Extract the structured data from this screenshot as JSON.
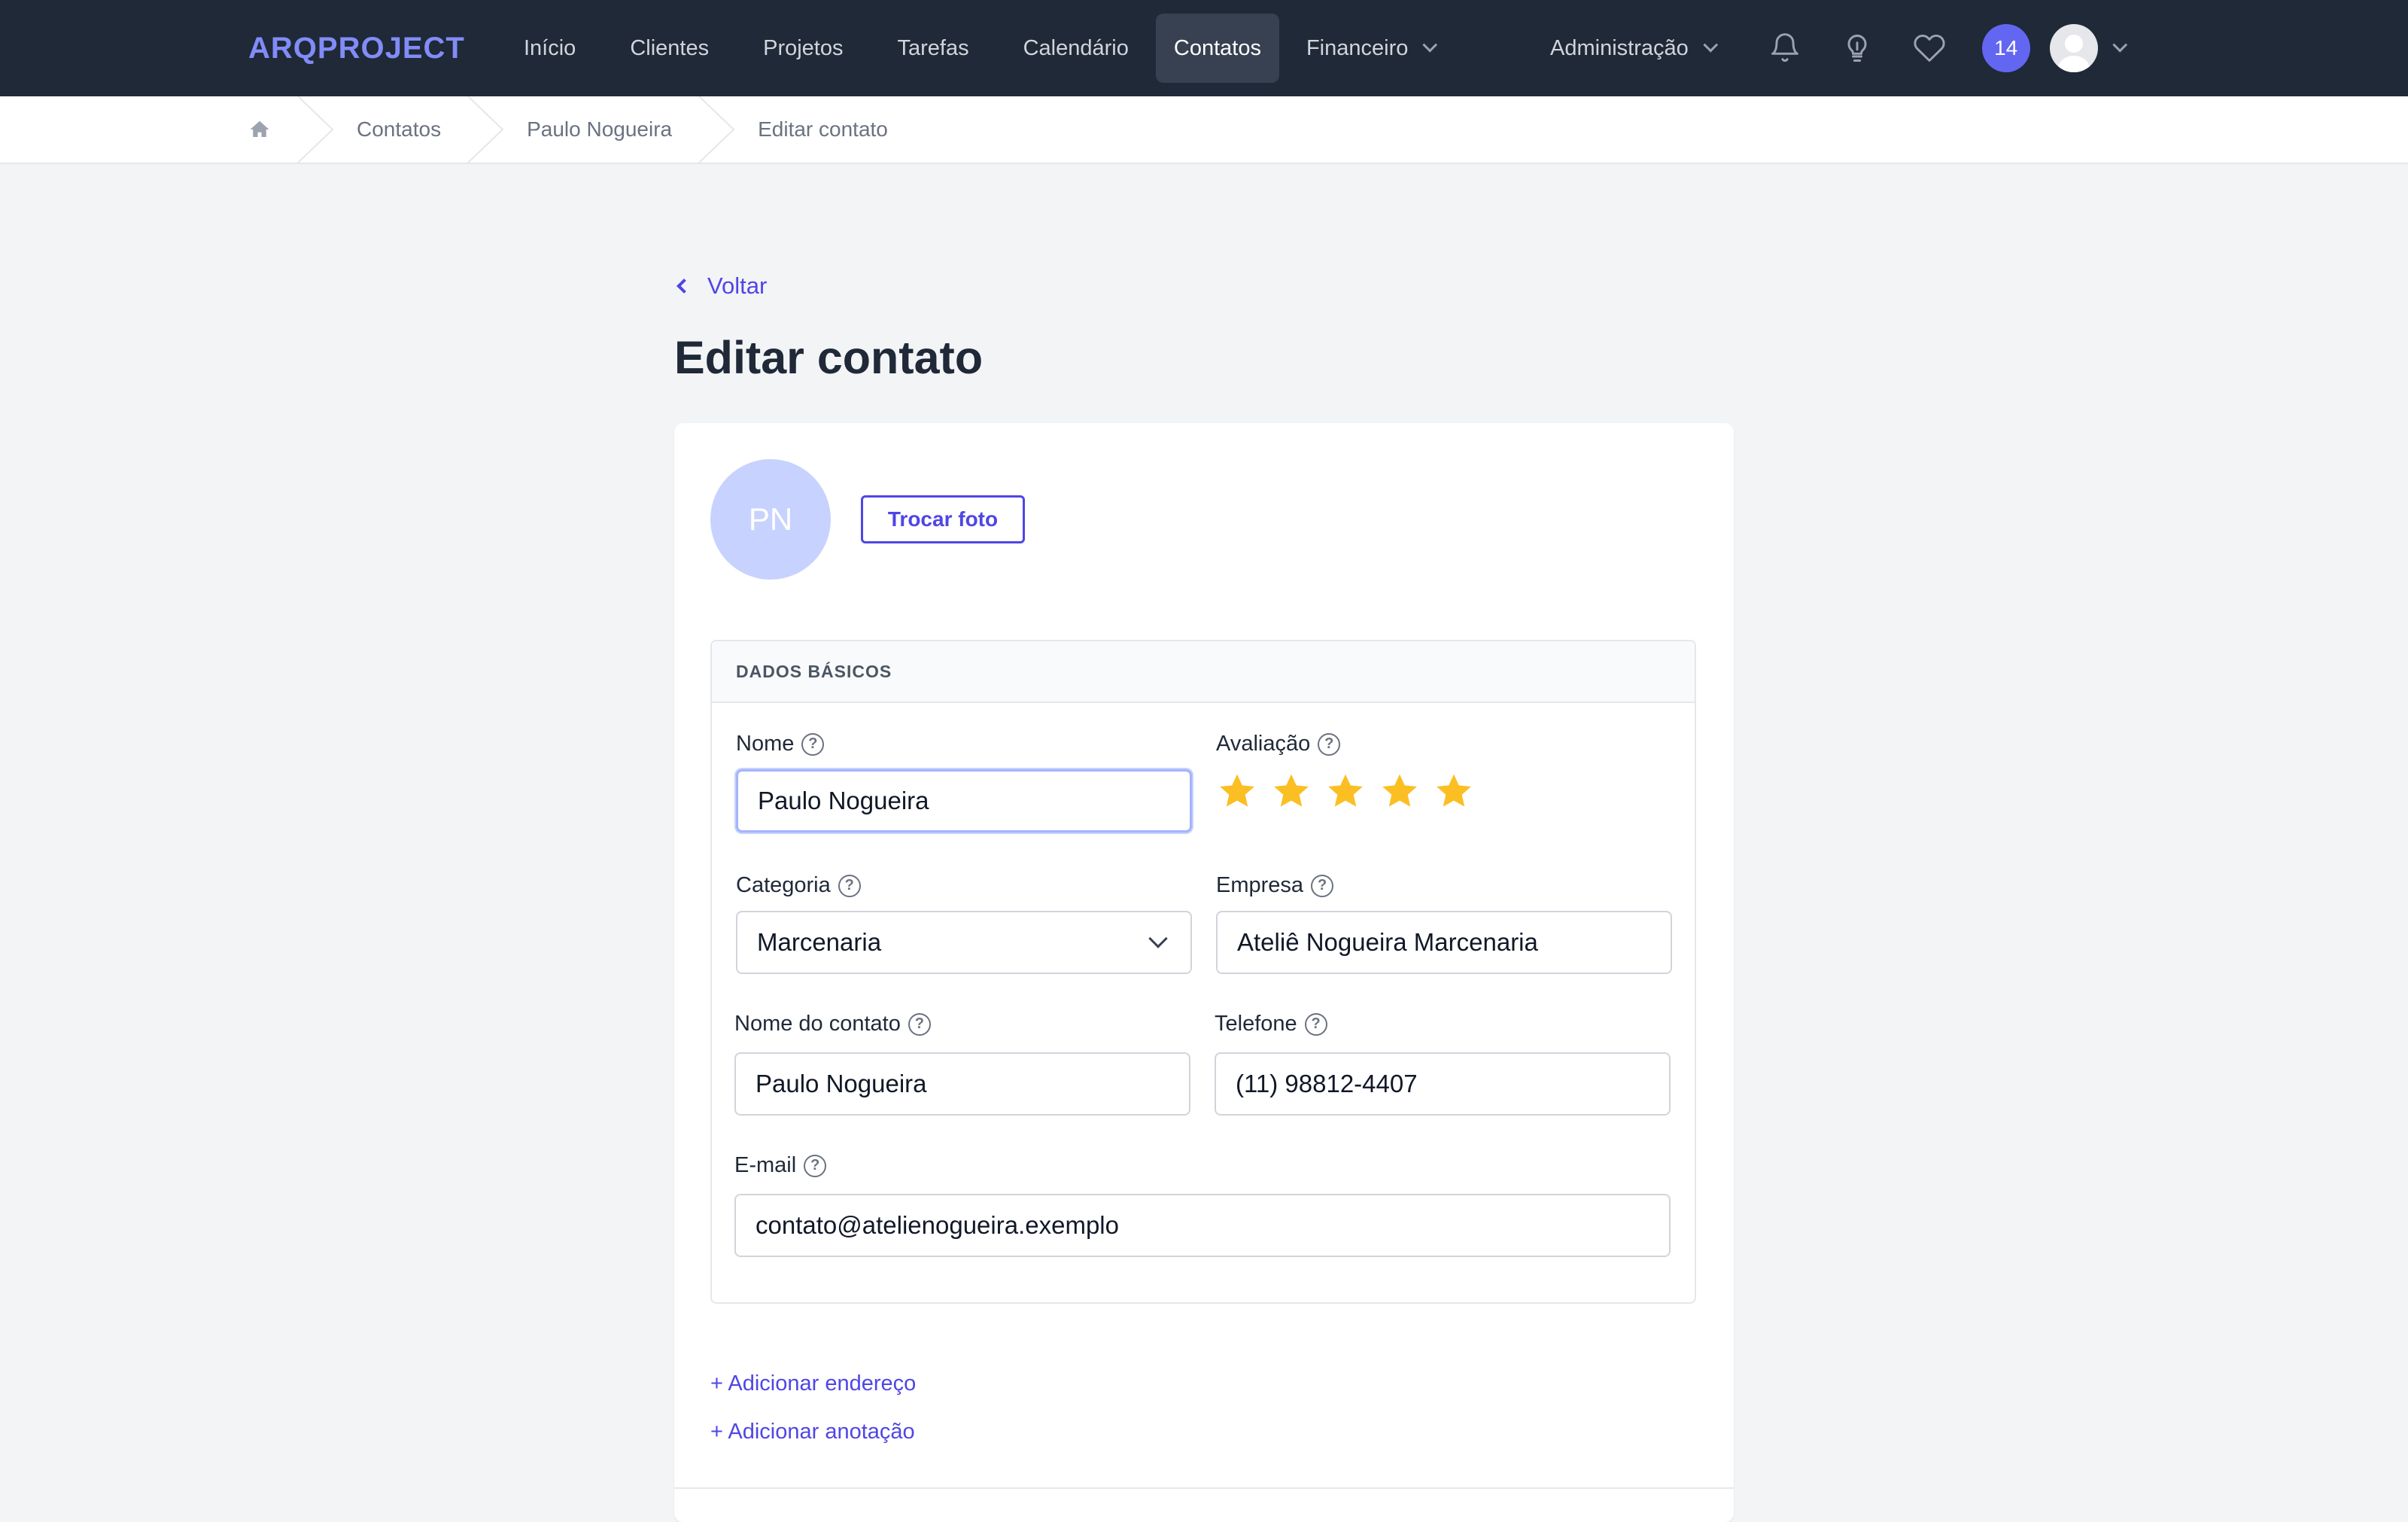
{
  "app": {
    "logo": "ARQPROJECT"
  },
  "nav": {
    "links": [
      "Início",
      "Clientes",
      "Projetos",
      "Tarefas",
      "Calendário",
      "Contatos",
      "Financeiro"
    ],
    "active": "Contatos",
    "admin": "Administração",
    "badge_count": "14"
  },
  "breadcrumb": {
    "items": [
      "Contatos",
      "Paulo Nogueira",
      "Editar contato"
    ]
  },
  "page": {
    "back": "Voltar",
    "title": "Editar contato"
  },
  "profile": {
    "initials": "PN",
    "change_photo": "Trocar foto"
  },
  "section": {
    "title": "DADOS BÁSICOS",
    "fields": {
      "nome": {
        "label": "Nome",
        "value": "Paulo Nogueira"
      },
      "avaliacao": {
        "label": "Avaliação",
        "stars": 5,
        "max": 5
      },
      "categoria": {
        "label": "Categoria",
        "value": "Marcenaria"
      },
      "empresa": {
        "label": "Empresa",
        "value": "Ateliê Nogueira Marcenaria"
      },
      "nome_contato": {
        "label": "Nome do contato",
        "value": "Paulo Nogueira"
      },
      "telefone": {
        "label": "Telefone",
        "value": "(11) 98812-4407"
      },
      "email": {
        "label": "E-mail",
        "value": "contato@atelienogueira.exemplo"
      }
    },
    "help_glyph": "?"
  },
  "actions": {
    "add_address": "+ Adicionar endereço",
    "add_note": "+ Adicionar anotação"
  },
  "colors": {
    "accent": "#4f46e5",
    "navbar": "#1f2937",
    "star": "#fbbf24"
  }
}
